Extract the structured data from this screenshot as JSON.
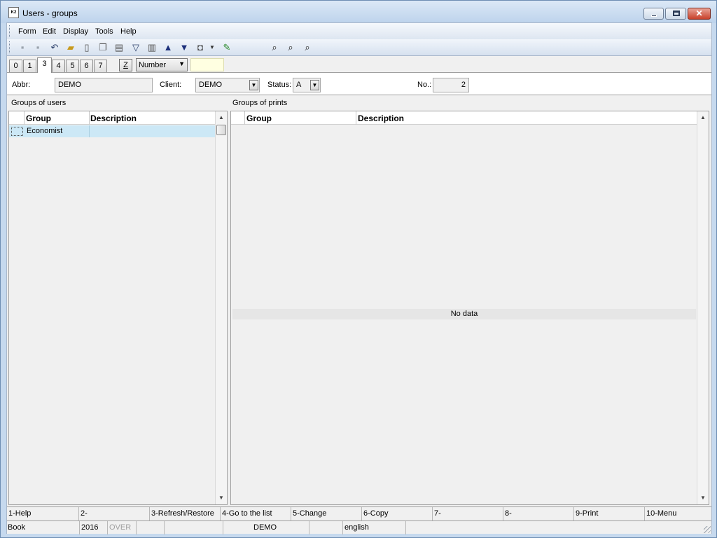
{
  "window": {
    "title": "Users - groups",
    "icon_text": "K2"
  },
  "menu": [
    "Form",
    "Edit",
    "Display",
    "Tools",
    "Help"
  ],
  "tabs": [
    "0",
    "1",
    "3",
    "4",
    "5",
    "6",
    "7"
  ],
  "active_tab": "3",
  "sort": {
    "z_label": "Z",
    "selected": "Number"
  },
  "form": {
    "abbr_label": "Abbr:",
    "abbr_value": "DEMO",
    "client_label": "Client:",
    "client_value": "DEMO",
    "status_label": "Status:",
    "status_value": "A",
    "no_label": "No.:",
    "no_value": "2"
  },
  "left_panel": {
    "title": "Groups of users",
    "columns": [
      "Group",
      "Description"
    ],
    "rows": [
      {
        "group": "Economist",
        "description": ""
      }
    ]
  },
  "right_panel": {
    "title": "Groups of prints",
    "columns": [
      "Group",
      "Description"
    ],
    "empty_text": "No data"
  },
  "function_keys": [
    "1-Help",
    "2-",
    "3-Refresh/Restore",
    "4-Go to the list",
    "5-Change",
    "6-Copy",
    "7-",
    "8-",
    "9-Print",
    "10-Menu"
  ],
  "status_bar": {
    "book": "Book",
    "year": "2016",
    "mode": "OVER",
    "user": "DEMO",
    "language": "english"
  },
  "icons": [
    "save-icon",
    "save-all-icon",
    "undo-icon",
    "open-folder-icon",
    "new-document-icon",
    "copy-icon",
    "book-icon",
    "filter-icon",
    "filter-list-icon",
    "arrow-up-icon",
    "arrow-down-icon",
    "camera-icon",
    "export-icon",
    "find-icon",
    "find-next-icon",
    "find-replace-icon"
  ]
}
